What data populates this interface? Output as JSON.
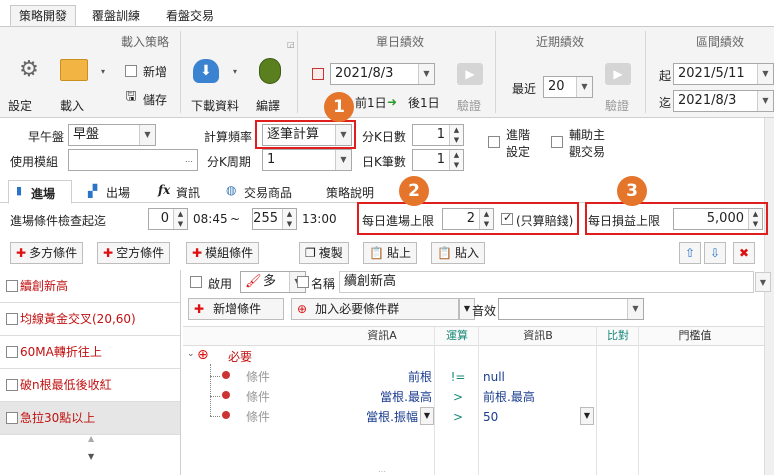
{
  "tabs": [
    "策略開發",
    "覆盤訓練",
    "看盤交易"
  ],
  "ribbon": {
    "groups": [
      "載入策略",
      "單日績效",
      "近期績效",
      "區間績效"
    ],
    "buttons": {
      "settings": "設定",
      "load": "載入",
      "new": "新增",
      "save": "儲存",
      "download": "下載資料",
      "compile": "編譯",
      "prev_day": "前1日",
      "next_day": "後1日",
      "verify1": "驗證",
      "verify2": "驗證"
    },
    "single_date": "2021/8/3",
    "recent_label": "最近",
    "recent_value": "20",
    "from_label": "起",
    "from_date": "2021/5/11",
    "to_label": "迄",
    "to_date": "2021/8/3"
  },
  "params": {
    "session_label": "早午盤",
    "session_value": "早盤",
    "module_label": "使用模組",
    "module_value": "",
    "freq_label": "計算頻率",
    "freq_value": "逐筆計算",
    "kperiod_label": "分K周期",
    "kperiod_value": "1",
    "kdays_label": "分K日數",
    "kdays_value": "1",
    "dayk_label": "日K筆數",
    "dayk_value": "1",
    "advanced_label1": "進階",
    "advanced_label2": "設定",
    "assist_label1": "輔助主",
    "assist_label2": "觀交易"
  },
  "subtabs": [
    "進場",
    "出場",
    "資訊",
    "交易商品",
    "策略說明"
  ],
  "entry": {
    "time_label": "進場條件檢查起迄",
    "start_value": "0",
    "start_time": "08:45",
    "tilde": "~",
    "end_value": "255",
    "end_time": "13:00",
    "daily_limit_label": "每日進場上限",
    "daily_limit_value": "2",
    "loss_only_label": "(只算賠錢)",
    "daily_profit_label": "每日損益上限",
    "daily_profit_value": "5,000"
  },
  "toolbar": {
    "long_cond": "多方條件",
    "short_cond": "空方條件",
    "module_cond": "模組條件",
    "copy": "複製",
    "paste_up": "貼上",
    "paste_in": "貼入"
  },
  "conditions_list": [
    "續創新高",
    "均線黃金交叉(20,60)",
    "60MA轉折往上",
    "破n根最低後收紅",
    "急拉30點以上"
  ],
  "detail": {
    "enable_label": "啟用",
    "direction_value": "多",
    "name_label": "名稱",
    "name_value": "續創新高",
    "add_cond": "新增條件",
    "add_required": "加入必要條件群",
    "sound_label": "音效",
    "sound_value": "",
    "headers": [
      "資訊A",
      "運算",
      "資訊B",
      "比對",
      "門檻值"
    ],
    "group_label": "必要",
    "rows": [
      {
        "label": "條件",
        "a": "前根",
        "op": "!=",
        "b": "null"
      },
      {
        "label": "條件",
        "a": "當根.最高",
        "op": ">",
        "b": "前根.最高"
      },
      {
        "label": "條件",
        "a": "當根.振幅",
        "op": ">",
        "b": "50"
      }
    ]
  },
  "badges": [
    "1",
    "2",
    "3"
  ]
}
